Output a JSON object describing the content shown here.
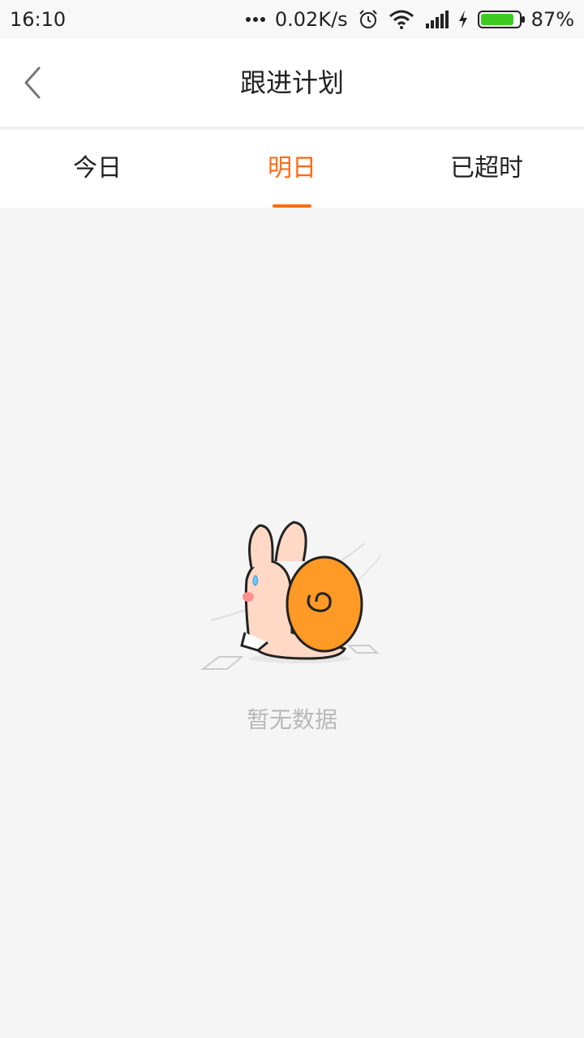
{
  "status_bar": {
    "time": "16:10",
    "network_speed": "0.02K/s",
    "battery_percent": "87%",
    "battery_level": 0.87,
    "icons": [
      "more-dots-icon",
      "alarm-icon",
      "wifi-icon",
      "signal-icon",
      "charging-icon",
      "battery-icon"
    ]
  },
  "header": {
    "title": "跟进计划",
    "back_icon": "chevron-left-icon"
  },
  "tabs": [
    {
      "label": "今日",
      "active": false
    },
    {
      "label": "明日",
      "active": true
    },
    {
      "label": "已超时",
      "active": false
    }
  ],
  "empty_state": {
    "message": "暂无数据",
    "illustration": "snail-rabbit-illustration"
  },
  "colors": {
    "accent": "#ff6a13",
    "background": "#f5f5f5",
    "muted_text": "#b8b8b8",
    "battery_green": "#3ecb21"
  }
}
